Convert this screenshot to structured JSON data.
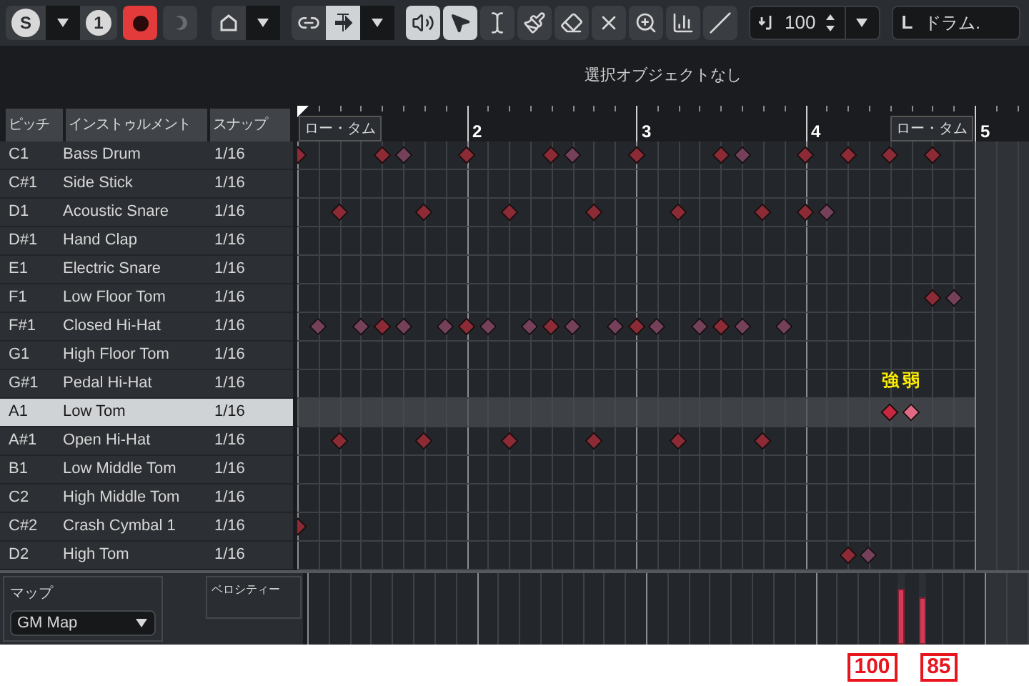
{
  "toolbar": {
    "solo": "S",
    "track_number": "1",
    "record_on": true,
    "quantize": "100",
    "drum_prefix": "L",
    "drum_map": "ドラム.",
    "tools": [
      {
        "kind": "link",
        "selected": false
      },
      {
        "kind": "snap",
        "selected": true
      },
      {
        "kind": "speaker",
        "selected": true
      },
      {
        "kind": "pointer",
        "selected": true
      },
      {
        "kind": "range",
        "selected": false
      },
      {
        "kind": "brush",
        "selected": false
      },
      {
        "kind": "eraser",
        "selected": false
      },
      {
        "kind": "mute",
        "selected": false
      },
      {
        "kind": "zoom",
        "selected": false
      },
      {
        "kind": "velocity",
        "selected": false
      },
      {
        "kind": "line",
        "selected": false
      }
    ]
  },
  "info_line": "選択オブジェクトなし",
  "columns": [
    "ピッチ",
    "インストゥルメント",
    "スナップ"
  ],
  "ruler": {
    "bars": [
      "2",
      "3",
      "4",
      "5"
    ],
    "markers": [
      "ロー・タム",
      "ロー・タム"
    ]
  },
  "rows": [
    {
      "pitch": "C1",
      "instrument": "Bass Drum",
      "snap": "1/16",
      "selected": false,
      "notes": [
        {
          "level": 0,
          "soft": false
        },
        {
          "level": 0.125,
          "soft": false
        },
        {
          "level": 0.15625,
          "soft": true
        },
        {
          "level": 0.25,
          "soft": false
        },
        {
          "level": 0.375,
          "soft": false
        },
        {
          "level": 0.40625,
          "soft": true
        },
        {
          "level": 0.5,
          "soft": false
        },
        {
          "level": 0.625,
          "soft": false
        },
        {
          "level": 0.65625,
          "soft": true
        },
        {
          "level": 0.75,
          "soft": false
        },
        {
          "level": 0.8125,
          "soft": false
        },
        {
          "level": 0.875,
          "soft": false
        },
        {
          "level": 0.9375,
          "soft": false
        }
      ]
    },
    {
      "pitch": "C#1",
      "instrument": "Side Stick",
      "snap": "1/16",
      "selected": false,
      "notes": []
    },
    {
      "pitch": "D1",
      "instrument": "Acoustic Snare",
      "snap": "1/16",
      "selected": false,
      "notes": [
        {
          "level": 0.0625,
          "soft": false
        },
        {
          "level": 0.1875,
          "soft": false
        },
        {
          "level": 0.3125,
          "soft": false
        },
        {
          "level": 0.4375,
          "soft": false
        },
        {
          "level": 0.5625,
          "soft": false
        },
        {
          "level": 0.6875,
          "soft": false
        },
        {
          "level": 0.75,
          "soft": false
        },
        {
          "level": 0.78125,
          "soft": true
        }
      ]
    },
    {
      "pitch": "D#1",
      "instrument": "Hand Clap",
      "snap": "1/16",
      "selected": false,
      "notes": []
    },
    {
      "pitch": "E1",
      "instrument": "Electric Snare",
      "snap": "1/16",
      "selected": false,
      "notes": []
    },
    {
      "pitch": "F1",
      "instrument": "Low Floor Tom",
      "snap": "1/16",
      "selected": false,
      "notes": [
        {
          "level": 0.9375,
          "soft": false
        },
        {
          "level": 0.96875,
          "soft": true
        }
      ]
    },
    {
      "pitch": "F#1",
      "instrument": "Closed Hi-Hat",
      "snap": "1/16",
      "selected": false,
      "notes": [
        {
          "level": 0.03125,
          "soft": true
        },
        {
          "level": 0.09375,
          "soft": true
        },
        {
          "level": 0.125,
          "soft": false
        },
        {
          "level": 0.15625,
          "soft": true
        },
        {
          "level": 0.21875,
          "soft": true
        },
        {
          "level": 0.25,
          "soft": false
        },
        {
          "level": 0.28125,
          "soft": true
        },
        {
          "level": 0.34375,
          "soft": true
        },
        {
          "level": 0.375,
          "soft": false
        },
        {
          "level": 0.40625,
          "soft": true
        },
        {
          "level": 0.46875,
          "soft": true
        },
        {
          "level": 0.5,
          "soft": false
        },
        {
          "level": 0.53125,
          "soft": true
        },
        {
          "level": 0.59375,
          "soft": true
        },
        {
          "level": 0.625,
          "soft": false
        },
        {
          "level": 0.65625,
          "soft": true
        },
        {
          "level": 0.71875,
          "soft": true
        }
      ]
    },
    {
      "pitch": "G1",
      "instrument": "High Floor Tom",
      "snap": "1/16",
      "selected": false,
      "notes": []
    },
    {
      "pitch": "G#1",
      "instrument": "Pedal Hi-Hat",
      "snap": "1/16",
      "selected": false,
      "notes": []
    },
    {
      "pitch": "A1",
      "instrument": "Low Tom",
      "snap": "1/16",
      "selected": true,
      "notes": [
        {
          "level": 0.875,
          "soft": false
        },
        {
          "level": 0.90625,
          "soft": true
        }
      ]
    },
    {
      "pitch": "A#1",
      "instrument": "Open Hi-Hat",
      "snap": "1/16",
      "selected": false,
      "notes": [
        {
          "level": 0.0625,
          "soft": false
        },
        {
          "level": 0.1875,
          "soft": false
        },
        {
          "level": 0.3125,
          "soft": false
        },
        {
          "level": 0.4375,
          "soft": false
        },
        {
          "level": 0.5625,
          "soft": false
        },
        {
          "level": 0.6875,
          "soft": false
        }
      ]
    },
    {
      "pitch": "B1",
      "instrument": "Low Middle Tom",
      "snap": "1/16",
      "selected": false,
      "notes": []
    },
    {
      "pitch": "C2",
      "instrument": "High Middle Tom",
      "snap": "1/16",
      "selected": false,
      "notes": []
    },
    {
      "pitch": "C#2",
      "instrument": "Crash Cymbal 1",
      "snap": "1/16",
      "selected": false,
      "notes": [
        {
          "level": 0,
          "soft": false
        }
      ]
    },
    {
      "pitch": "D2",
      "instrument": "High Tom",
      "snap": "1/16",
      "selected": false,
      "notes": [
        {
          "level": 0.8125,
          "soft": false
        },
        {
          "level": 0.84375,
          "soft": true
        }
      ]
    }
  ],
  "map": {
    "label": "マップ",
    "value": "GM Map"
  },
  "velocity_lane": {
    "label": "ベロシティー",
    "bars": [
      {
        "level": 0.79
      },
      {
        "level": 0.67
      }
    ]
  },
  "annotations": [
    {
      "text": "強",
      "callout": "100"
    },
    {
      "text": "弱",
      "callout": "85"
    }
  ]
}
